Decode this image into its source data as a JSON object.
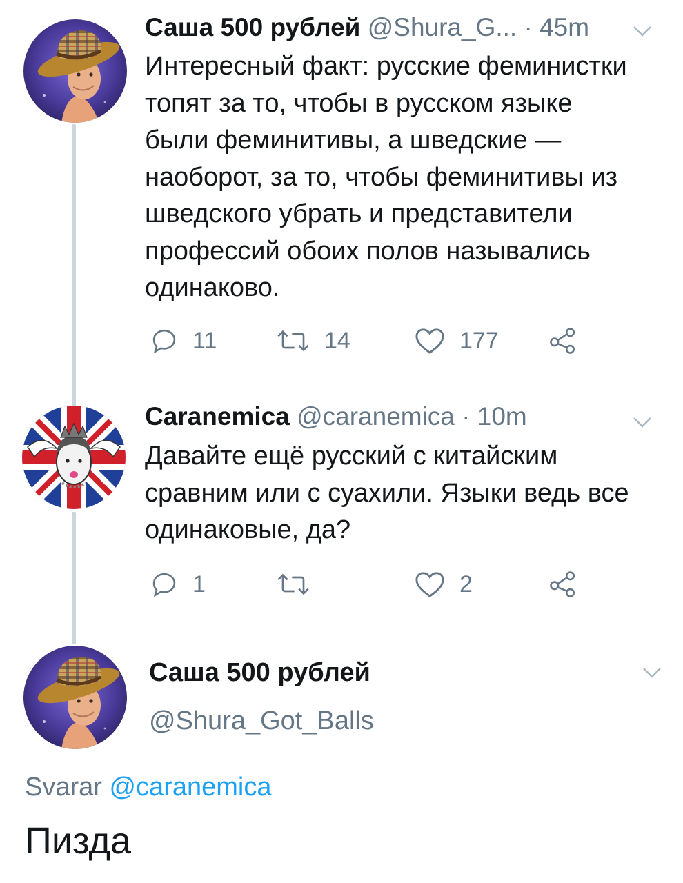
{
  "tweets": [
    {
      "name": "Саша 500 рублей",
      "handle": "@Shura_G...",
      "separator": "·",
      "time": "45m",
      "text": "Интересный факт: русские феминистки топят за то, чтобы в русском языке были феминитивы, а шведские — наоборот, за то, чтобы феминитивы из шведского убрать и представители профессий обоих полов назывались одинаково.",
      "reply_count": "11",
      "retweet_count": "14",
      "like_count": "177"
    },
    {
      "name": "Caranemica",
      "handle": "@caranemica",
      "separator": "·",
      "time": "10m",
      "text": "Давайте ещё русский с китайским сравним или с суахили. Языки ведь все одинаковые, да?",
      "reply_count": "1",
      "retweet_count": "",
      "like_count": "2"
    }
  ],
  "focused": {
    "name": "Саша 500 рублей",
    "handle": "@Shura_Got_Balls",
    "reply_prefix": "Svarar",
    "reply_to": "@caranemica",
    "text": "Пизда"
  },
  "icons": {
    "reply": "reply-icon",
    "retweet": "retweet-icon",
    "like": "heart-icon",
    "share": "share-icon",
    "menu": "chevron-down-icon"
  },
  "colors": {
    "link": "#1da1f2",
    "secondary_text": "#657786",
    "primary_text": "#14171a",
    "thread_line": "#ccd6dd"
  }
}
